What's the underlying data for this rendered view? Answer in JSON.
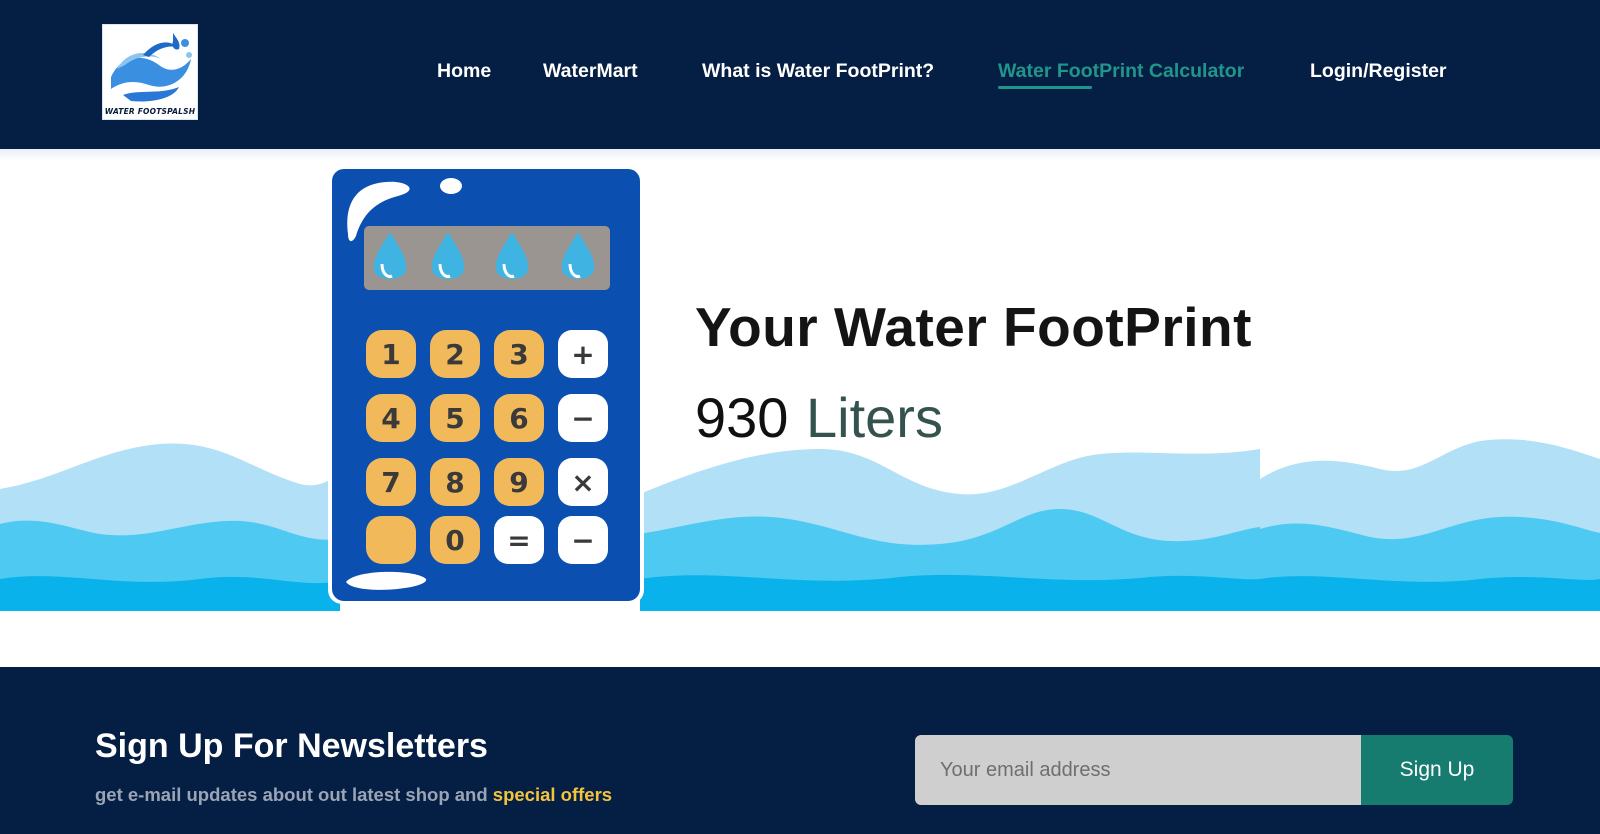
{
  "brand": {
    "logo_text": "WATER FOOTSPALSH"
  },
  "nav": {
    "items": [
      {
        "label": "Home",
        "active": false
      },
      {
        "label": "WaterMart",
        "active": false
      },
      {
        "label": "What is Water FootPrint?",
        "active": false
      },
      {
        "label": "Water FootPrint Calculator",
        "active": true
      },
      {
        "label": "Login/Register",
        "active": false
      }
    ]
  },
  "hero": {
    "title": "Your Water FootPrint",
    "value": "930",
    "unit": "Liters",
    "calculator_keys": [
      "1",
      "2",
      "3",
      "+",
      "4",
      "5",
      "6",
      "−",
      "7",
      "8",
      "9",
      "×",
      "",
      "0",
      "=",
      "−"
    ]
  },
  "newsletter": {
    "title": "Sign Up For Newsletters",
    "subtitle_prefix": "get e-mail updates about out latest shop and ",
    "subtitle_highlight": "special offers",
    "email_placeholder": "Your email address",
    "button_label": "Sign Up"
  },
  "colors": {
    "header_bg": "#051e43",
    "accent_teal": "#22958a",
    "button_teal": "#167c70",
    "highlight_yellow": "#f3c33b",
    "calculator_blue": "#0b4fb0",
    "key_orange": "#f2b95b",
    "wave_light": "#b1e0f7",
    "wave_mid": "#4ec9f1",
    "wave_deep": "#09b2ea"
  }
}
